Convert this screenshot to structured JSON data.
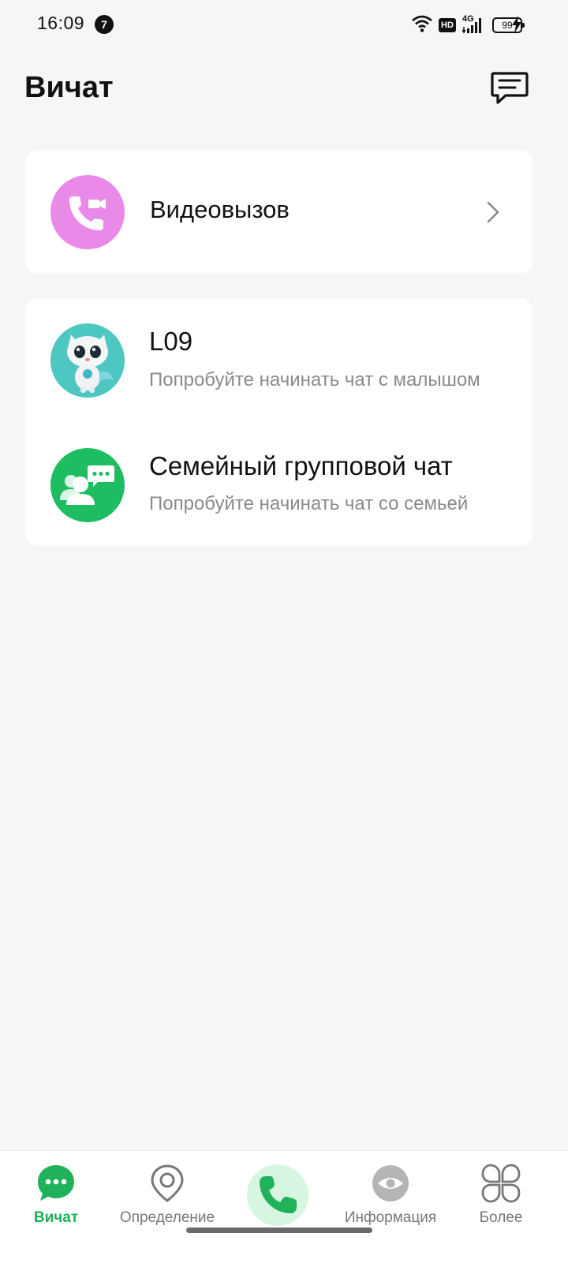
{
  "status_bar": {
    "time": "16:09",
    "notification_count": "7",
    "hd_label": "HD",
    "network_label": "4G",
    "battery_level": "99"
  },
  "header": {
    "title": "Вичат"
  },
  "video_card": {
    "label": "Видеовызов"
  },
  "chats": [
    {
      "title": "L09",
      "subtitle": "Попробуйте начинать чат с малышом"
    },
    {
      "title": "Семейный групповой чат",
      "subtitle": "Попробуйте начинать чат со семьей"
    }
  ],
  "bottom_nav": {
    "items": [
      {
        "label": "Вичат",
        "icon": "chat-bubble-icon",
        "active": true
      },
      {
        "label": "Определение",
        "icon": "location-pin-icon",
        "active": false
      },
      {
        "label": "",
        "icon": "phone-icon",
        "active": false
      },
      {
        "label": "Информация",
        "icon": "eye-icon",
        "active": false
      },
      {
        "label": "Более",
        "icon": "four-leaf-grid-icon",
        "active": false
      }
    ]
  },
  "colors": {
    "accent_green": "#1fb25a",
    "video_avatar": "#e98ae8",
    "l09_avatar": "#4ec6c2",
    "family_avatar": "#1fbd61",
    "background": "#f6f6f6"
  }
}
